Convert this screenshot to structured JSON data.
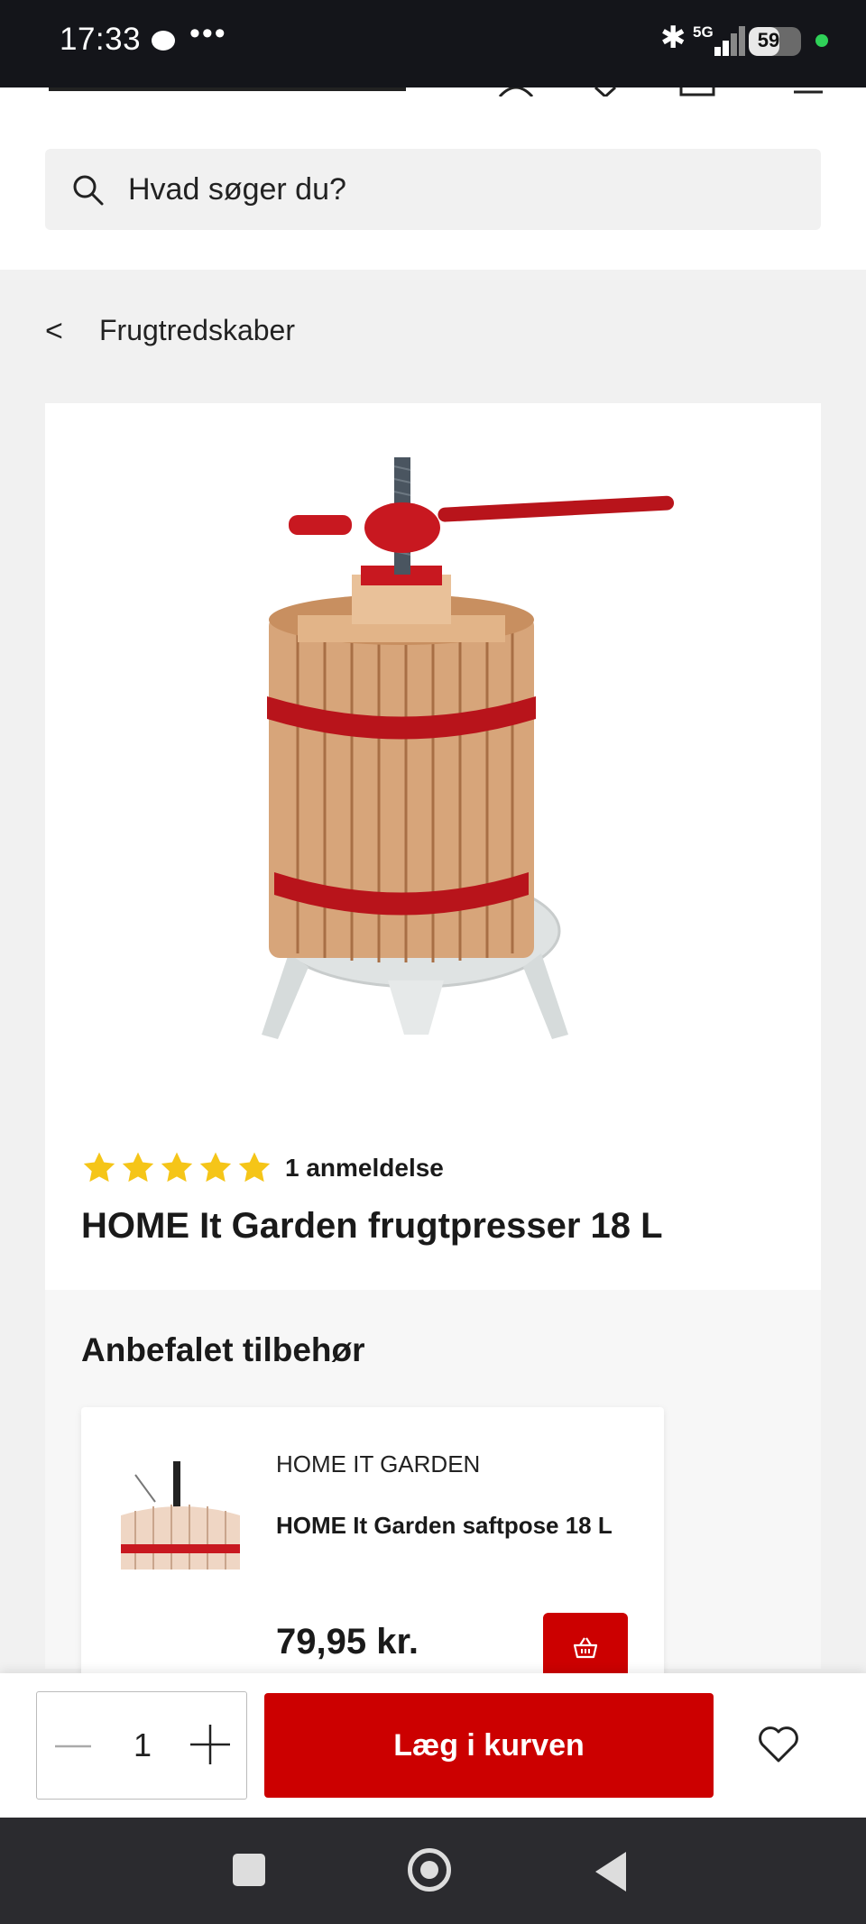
{
  "status_bar": {
    "time": "17:33",
    "dots": "•••",
    "network": "5G",
    "battery": "59"
  },
  "search": {
    "placeholder": "Hvad søger du?"
  },
  "breadcrumb": {
    "back": "<",
    "label": "Frugtredskaber"
  },
  "product": {
    "rating_stars": 5,
    "review_count": "1 anmeldelse",
    "title": "HOME It Garden frugtpresser 18 L"
  },
  "accessories": {
    "heading": "Anbefalet tilbehør",
    "items": [
      {
        "brand": "HOME IT GARDEN",
        "name": "HOME It Garden saftpose 18 L",
        "price": "79,95 kr."
      }
    ]
  },
  "action_bar": {
    "quantity": "1",
    "add_to_cart_label": "Læg i kurven"
  },
  "colors": {
    "accent": "#cc0000",
    "star": "#f5c518",
    "nav_bg": "#2b2b2f",
    "status_bg": "#14151a"
  }
}
